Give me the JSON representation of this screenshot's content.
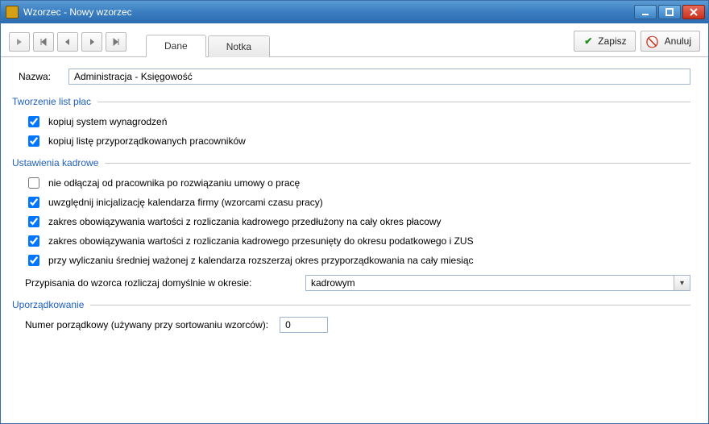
{
  "window": {
    "title": "Wzorzec - Nowy wzorzec"
  },
  "tabs": {
    "dane": "Dane",
    "notka": "Notka"
  },
  "actions": {
    "save": "Zapisz",
    "cancel": "Anuluj"
  },
  "form": {
    "name_label": "Nazwa:",
    "name_value": "Administracja - Księgowość"
  },
  "sections": {
    "payroll_title": "Tworzenie list płac",
    "hr_title": "Ustawienia kadrowe",
    "order_title": "Uporządkowanie"
  },
  "payroll": {
    "copy_system": "kopiuj system wynagrodzeń",
    "copy_list": "kopiuj listę przyporządkowanych pracowników"
  },
  "hr": {
    "no_detach": "nie odłączaj od pracownika po rozwiązaniu umowy o pracę",
    "calendar_init": "uwzględnij inicjalizację kalendarza firmy (wzorcami czasu pracy)",
    "extend_payroll": "zakres obowiązywania wartości z rozliczania kadrowego przedłużony na cały okres płacowy",
    "shift_tax": "zakres obowiązywania wartości z rozliczania kadrowego przesunięty do okresu podatkowego i ZUS",
    "avg_month": "przy wyliczaniu średniej ważonej z kalendarza rozszerzaj okres przyporządkowania na cały miesiąc",
    "assign_label": "Przypisania do wzorca rozliczaj domyślnie w okresie:",
    "assign_value": "kadrowym"
  },
  "order": {
    "label": "Numer porządkowy (używany przy sortowaniu wzorców):",
    "value": "0"
  }
}
